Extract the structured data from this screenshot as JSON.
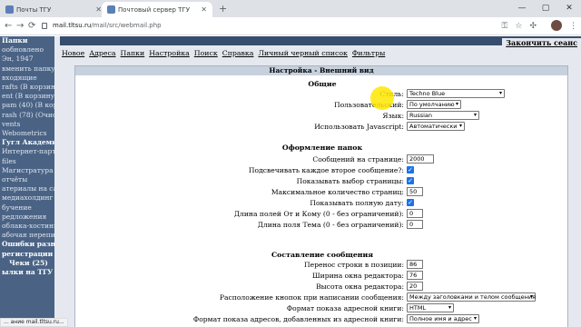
{
  "browser": {
    "tabs": [
      {
        "title": "Почты ТГУ"
      },
      {
        "title": "Почтовый сервер ТГУ"
      }
    ],
    "new_tab_icon": "+",
    "window_buttons": [
      "—",
      "▢",
      "✕"
    ],
    "back_icon": "←",
    "forward_icon": "→",
    "reload_icon": "⟳",
    "url_host": "mail.tltsu.ru",
    "url_path": "/mail/src/webmail.php",
    "toolbar_icons": [
      "key-icon",
      "star-icon",
      "extensions-icon",
      "profile-icon",
      "menu-icon"
    ],
    "status": "... ание mail.tltsu.ru..."
  },
  "sidebar": {
    "items": [
      {
        "text": "Папки",
        "style": "b"
      },
      {
        "text": "ообновлено",
        "style": ""
      },
      {
        "text": "Эн, 1947",
        "style": ""
      },
      {
        "text": "вменить папку)",
        "style": ""
      },
      {
        "text": "",
        "style": ""
      },
      {
        "text": "входящие",
        "style": ""
      },
      {
        "text": "rafts (В корзину)",
        "style": ""
      },
      {
        "text": "ent (В корзину)",
        "style": ""
      },
      {
        "text": "pam (40) (В корзину)",
        "style": ""
      },
      {
        "text": "rash (78) (Очистить)",
        "style": ""
      },
      {
        "text": "vents",
        "style": ""
      },
      {
        "text": "Webometrics",
        "style": ""
      },
      {
        "text": "Гугл Академия",
        "style": "b"
      },
      {
        "text": "Интернет-партнёр",
        "style": ""
      },
      {
        "text": "files",
        "style": ""
      },
      {
        "text": "Магистратура",
        "style": ""
      },
      {
        "text": "отчёты",
        "style": ""
      },
      {
        "text": "атериалы на сайт",
        "style": ""
      },
      {
        "text": "медиахолдинг",
        "style": ""
      },
      {
        "text": "бучение",
        "style": ""
      },
      {
        "text": "редложения",
        "style": ""
      },
      {
        "text": "облака-хостинг-1",
        "style": ""
      },
      {
        "text": "абочая переписка",
        "style": ""
      },
      {
        "text": "Ошибки разных",
        "style": "b"
      },
      {
        "text": "регистрации (1)",
        "style": "b"
      },
      {
        "text": "Чеки (25)",
        "style": "bc"
      },
      {
        "text": "ылки на ТГУ (2)",
        "style": "b"
      }
    ]
  },
  "header": {
    "top_right": "Закончить сеанс",
    "menu": [
      "Новое",
      "Адреса",
      "Папки",
      "Настройка",
      "Поиск",
      "Справка",
      "Личный черный список",
      "Фильтры"
    ]
  },
  "panel": {
    "title": "Настройка - Внешний вид",
    "sections": {
      "general": "Общие",
      "folders": "Оформление папок",
      "compose": "Составление сообщения"
    },
    "rows": [
      {
        "label": "Стиль:",
        "type": "select",
        "value": "Techno Blue"
      },
      {
        "label": "Пользовательский:",
        "type": "select",
        "value": "По умолчанию"
      },
      {
        "label": "Язык:",
        "type": "select",
        "value": "Russian"
      },
      {
        "label": "Использовать Javascript:",
        "type": "select",
        "value": "Автоматически"
      },
      {
        "label": "Сообщений на странице:",
        "type": "input",
        "value": "2000"
      },
      {
        "label": "Подсвечивать каждое второе сообщение?:",
        "type": "check",
        "value": "✓"
      },
      {
        "label": "Показывать выбор страницы:",
        "type": "check",
        "value": "✓"
      },
      {
        "label": "Максимальное количество страниц:",
        "type": "input",
        "value": "50"
      },
      {
        "label": "Показывать полную дату:",
        "type": "check",
        "value": "✓"
      },
      {
        "label": "Длина полей От и Кому (0 - без ограничений):",
        "type": "input",
        "value": "0"
      },
      {
        "label": "Длина поля Тема (0 - без ограничений):",
        "type": "input",
        "value": "0"
      },
      {
        "label": "Перенос строки в позиции:",
        "type": "input",
        "value": "86"
      },
      {
        "label": "Ширина окна редактора:",
        "type": "input",
        "value": "76"
      },
      {
        "label": "Высота окна редактора:",
        "type": "input",
        "value": "20"
      },
      {
        "label": "Расположение кнопок при написании сообщения:",
        "type": "select",
        "value": "Между заголовками и телом сообщения"
      },
      {
        "label": "Формат показа адресной книги:",
        "type": "select",
        "value": "HTML"
      },
      {
        "label": "Формат показа адресов, добавленных из адресной книги:",
        "type": "select",
        "value": "Полное имя и адрес"
      }
    ]
  },
  "colors": {
    "sidebar": "#4a6385",
    "content_bg": "#e5e9ef",
    "panel_title": "#c7d1de",
    "highlight": "#ffe600"
  }
}
